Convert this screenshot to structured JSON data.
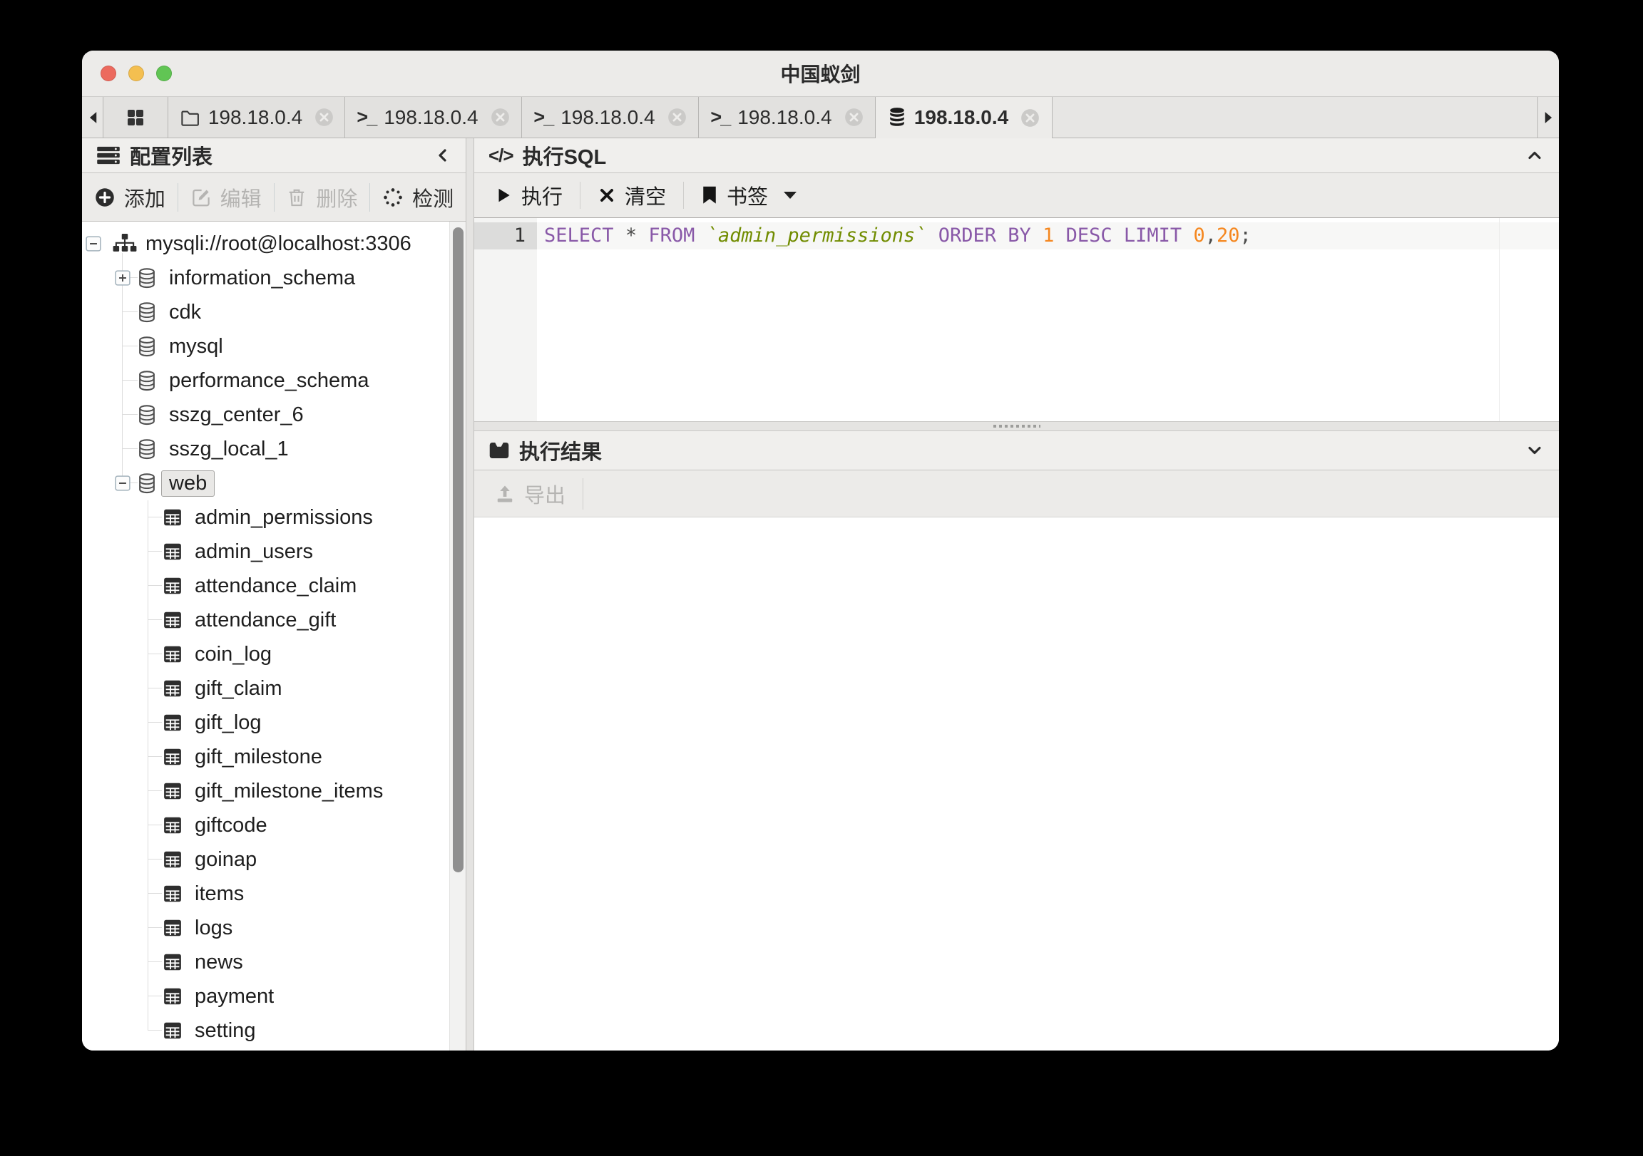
{
  "window": {
    "title": "中国蚁剑",
    "traffic_lights": [
      "#ec6a5e",
      "#f4bf50",
      "#61c554"
    ]
  },
  "tabbar": {
    "tabs": [
      {
        "id": "home",
        "icon": "grid",
        "label": "",
        "closable": false,
        "active": false
      },
      {
        "id": "files",
        "icon": "folder",
        "label": "198.18.0.4",
        "closable": true,
        "active": false
      },
      {
        "id": "terminal-1",
        "icon": "terminal",
        "label": "198.18.0.4",
        "closable": true,
        "active": false
      },
      {
        "id": "terminal-2",
        "icon": "terminal",
        "label": "198.18.0.4",
        "closable": true,
        "active": false
      },
      {
        "id": "terminal-3",
        "icon": "terminal",
        "label": "198.18.0.4",
        "closable": true,
        "active": false
      },
      {
        "id": "database",
        "icon": "database",
        "label": "198.18.0.4",
        "closable": true,
        "active": true
      }
    ]
  },
  "sidebar": {
    "title": "配置列表",
    "toolbar": [
      {
        "id": "add",
        "label": "添加",
        "icon": "plus-circle",
        "enabled": true
      },
      {
        "id": "edit",
        "label": "编辑",
        "icon": "edit",
        "enabled": false
      },
      {
        "id": "delete",
        "label": "删除",
        "icon": "trash",
        "enabled": false
      },
      {
        "id": "check",
        "label": "检测",
        "icon": "spinner",
        "enabled": true
      }
    ],
    "tree": {
      "root": {
        "label": "mysqli://root@localhost:3306",
        "icon": "sitemap",
        "expander": "minus"
      },
      "nodes": [
        {
          "label": "information_schema",
          "kind": "database",
          "expander": "plus"
        },
        {
          "label": "cdk",
          "kind": "database"
        },
        {
          "label": "mysql",
          "kind": "database"
        },
        {
          "label": "performance_schema",
          "kind": "database"
        },
        {
          "label": "sszg_center_6",
          "kind": "database"
        },
        {
          "label": "sszg_local_1",
          "kind": "database"
        },
        {
          "label": "web",
          "kind": "database",
          "expander": "minus",
          "selected": true
        },
        {
          "label": "admin_permissions",
          "kind": "table"
        },
        {
          "label": "admin_users",
          "kind": "table"
        },
        {
          "label": "attendance_claim",
          "kind": "table"
        },
        {
          "label": "attendance_gift",
          "kind": "table"
        },
        {
          "label": "coin_log",
          "kind": "table"
        },
        {
          "label": "gift_claim",
          "kind": "table"
        },
        {
          "label": "gift_log",
          "kind": "table"
        },
        {
          "label": "gift_milestone",
          "kind": "table"
        },
        {
          "label": "gift_milestone_items",
          "kind": "table"
        },
        {
          "label": "giftcode",
          "kind": "table"
        },
        {
          "label": "goinap",
          "kind": "table"
        },
        {
          "label": "items",
          "kind": "table"
        },
        {
          "label": "logs",
          "kind": "table"
        },
        {
          "label": "news",
          "kind": "table"
        },
        {
          "label": "payment",
          "kind": "table"
        },
        {
          "label": "setting",
          "kind": "table"
        }
      ]
    }
  },
  "sql_panel": {
    "title": "执行SQL",
    "toolbar": {
      "run": "执行",
      "clear": "清空",
      "bookmark": "书签"
    },
    "editor": {
      "line_number": "1",
      "tokens": [
        {
          "text": "SELECT",
          "type": "keyword"
        },
        {
          "text": " ",
          "type": "plain"
        },
        {
          "text": "*",
          "type": "plain"
        },
        {
          "text": " ",
          "type": "plain"
        },
        {
          "text": "FROM",
          "type": "keyword"
        },
        {
          "text": " ",
          "type": "plain"
        },
        {
          "text": "`admin_permissions`",
          "type": "identifier"
        },
        {
          "text": " ",
          "type": "plain"
        },
        {
          "text": "ORDER BY",
          "type": "keyword"
        },
        {
          "text": " ",
          "type": "plain"
        },
        {
          "text": "1",
          "type": "number"
        },
        {
          "text": " ",
          "type": "plain"
        },
        {
          "text": "DESC",
          "type": "keyword"
        },
        {
          "text": " ",
          "type": "plain"
        },
        {
          "text": "LIMIT",
          "type": "keyword"
        },
        {
          "text": " ",
          "type": "plain"
        },
        {
          "text": "0",
          "type": "number"
        },
        {
          "text": ",",
          "type": "plain"
        },
        {
          "text": "20",
          "type": "number"
        },
        {
          "text": ";",
          "type": "plain"
        }
      ]
    }
  },
  "result_panel": {
    "title": "执行结果",
    "export_label": "导出"
  },
  "colors": {
    "sql_keyword": "#8959a8",
    "sql_identifier": "#718c00",
    "sql_number": "#f5871f",
    "sql_plain": "#4d4d4c"
  }
}
